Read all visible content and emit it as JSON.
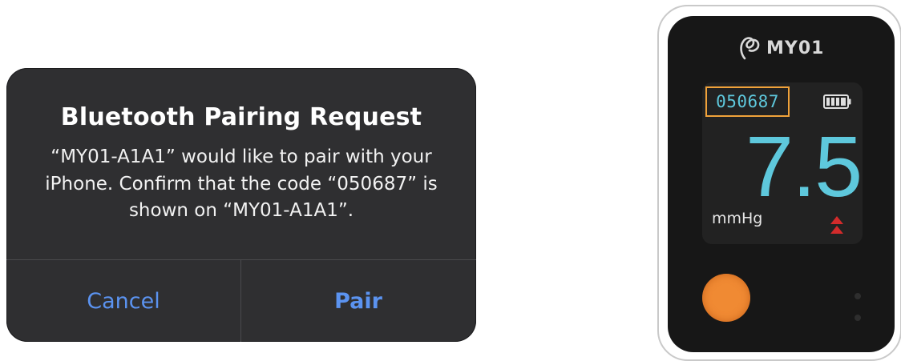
{
  "alert": {
    "title": "Bluetooth Pairing Request",
    "message": "“MY01-A1A1” would like to pair with your iPhone. Confirm that the code “050687” is shown on “MY01-A1A1”.",
    "cancel_label": "Cancel",
    "pair_label": "Pair"
  },
  "device": {
    "brand": "MY01",
    "brand_logo": "my01-logo-icon",
    "code": "050687",
    "battery_icon": "battery-full-icon",
    "reading": "7.5",
    "unit": "mmHg",
    "trend_icon": "double-up-arrow-icon",
    "button_icon": "orange-action-button"
  },
  "colors": {
    "alert_bg": "#2f2f31",
    "alert_button": "#5b93f0",
    "device_body": "#171717",
    "display_text": "#5ec8dc",
    "highlight_box": "#f0a23a",
    "action_button": "#f08a33",
    "trend_arrow": "#d22b2b"
  }
}
